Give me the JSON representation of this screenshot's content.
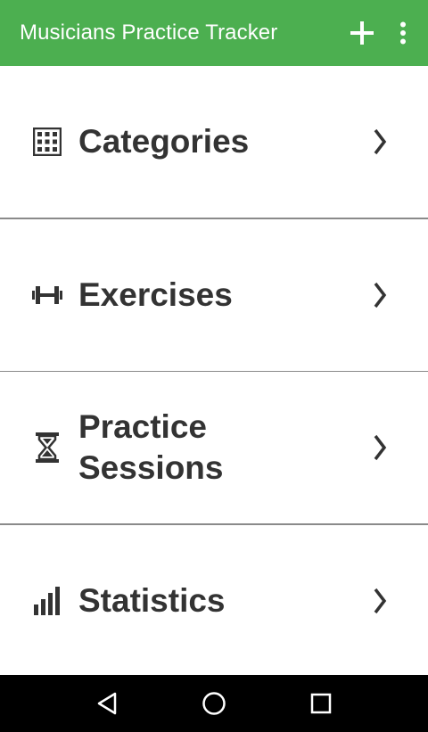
{
  "colors": {
    "appbar_bg": "#4CAF50",
    "text": "#333333",
    "icon": "#333333",
    "divider": "#8a8a8a",
    "navbar_bg": "#000000"
  },
  "appbar": {
    "title": "Musicians Practice Tracker",
    "add_icon": "plus-icon",
    "menu_icon": "more-vert-icon"
  },
  "menu": {
    "items": [
      {
        "label": "Categories",
        "icon": "grid-icon"
      },
      {
        "label": "Exercises",
        "icon": "dumbbell-icon"
      },
      {
        "label": "Practice Sessions",
        "icon": "hourglass-icon"
      },
      {
        "label": "Statistics",
        "icon": "bar-chart-icon"
      }
    ]
  },
  "navbar": {
    "back_icon": "back-triangle-icon",
    "home_icon": "home-circle-icon",
    "recents_icon": "recents-square-icon"
  }
}
